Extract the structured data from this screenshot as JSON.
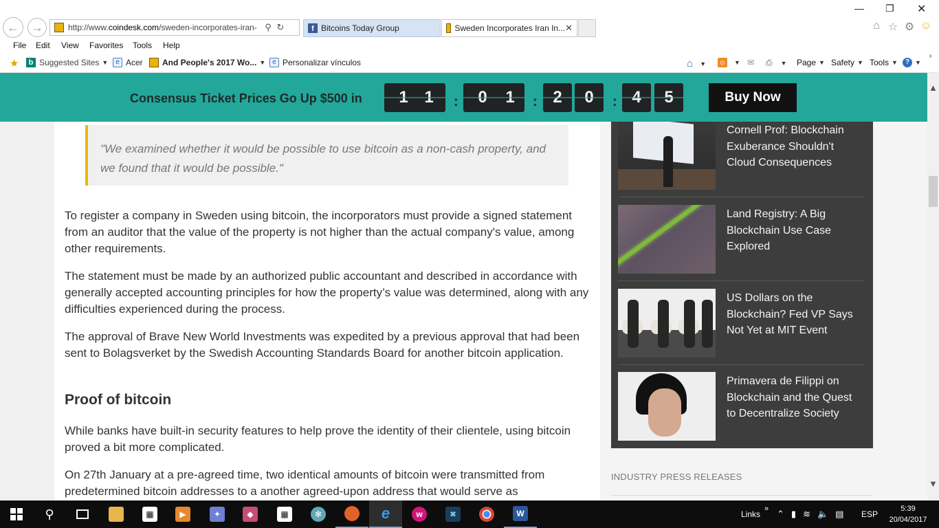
{
  "browser": {
    "address_url_prefix": "http://www.",
    "address_url_domain": "coindesk.com",
    "address_url_rest": "/sweden-incorporates-iran-",
    "tabs": [
      {
        "label": "Bitcoins Today Group",
        "icon": "facebook-icon"
      },
      {
        "label": "Sweden Incorporates Iran In...",
        "icon": "coindesk-icon",
        "active": true
      }
    ],
    "menu": [
      "File",
      "Edit",
      "View",
      "Favorites",
      "Tools",
      "Help"
    ],
    "favorites": [
      {
        "label": "Suggested Sites",
        "icon": "bing-icon",
        "dropdown": true
      },
      {
        "label": "Acer",
        "icon": "ie-icon"
      },
      {
        "label": "And People's 2017 Wo...",
        "icon": "coindesk-icon",
        "dropdown": true
      },
      {
        "label": "Personalizar vínculos",
        "icon": "ie-icon"
      }
    ],
    "command_bar": {
      "page": "Page",
      "safety": "Safety",
      "tools": "Tools"
    }
  },
  "banner": {
    "text": "Consensus Ticket Prices Go Up $500 in",
    "digits": [
      "1",
      "1",
      "0",
      "1",
      "2",
      "0",
      "4",
      "5"
    ],
    "button": "Buy Now",
    "accent_color": "#23a79a"
  },
  "article": {
    "quote": "\"We examined whether it would be possible to use bitcoin as a non-cash property, and we found that it would be possible.\"",
    "paragraphs": [
      "To register a company in Sweden using bitcoin, the incorporators must provide a signed statement from an auditor that the value of the property is not higher than the actual company's value, among other requirements.",
      "The statement must be made by an authorized public accountant and described in accordance with generally accepted accounting principles for how the property’s value was determined, along with any difficulties experienced during the process.",
      "The approval of Brave New World Investments was expedited by a previous approval that had been sent to Bolagsverket by the Swedish Accounting Standards Board for another bitcoin application.",
      "While banks have built-in security features to help prove the identity of their clientele, using bitcoin proved a bit more complicated.",
      "On 27th January at a pre-agreed time, two identical amounts of bitcoin were transmitted from predetermined bitcoin addresses to a another agreed-upon address that would serve as"
    ],
    "subheading": "Proof of bitcoin"
  },
  "sidebar": {
    "related": [
      {
        "title": "Cornell Prof: Blockchain Exuberance Shouldn't Cloud Consequences"
      },
      {
        "title": "Land Registry: A Big Blockchain Use Case Explored"
      },
      {
        "title": "US Dollars on the Blockchain? Fed VP Says Not Yet at MIT Event"
      },
      {
        "title": "Primavera de Filippi on Blockchain and the Quest to Decentralize Society"
      }
    ],
    "press_heading": "INDUSTRY PRESS RELEASES"
  },
  "taskbar": {
    "links_label": "Links",
    "language": "ESP",
    "time": "5:39",
    "date": "20/04/2017"
  }
}
